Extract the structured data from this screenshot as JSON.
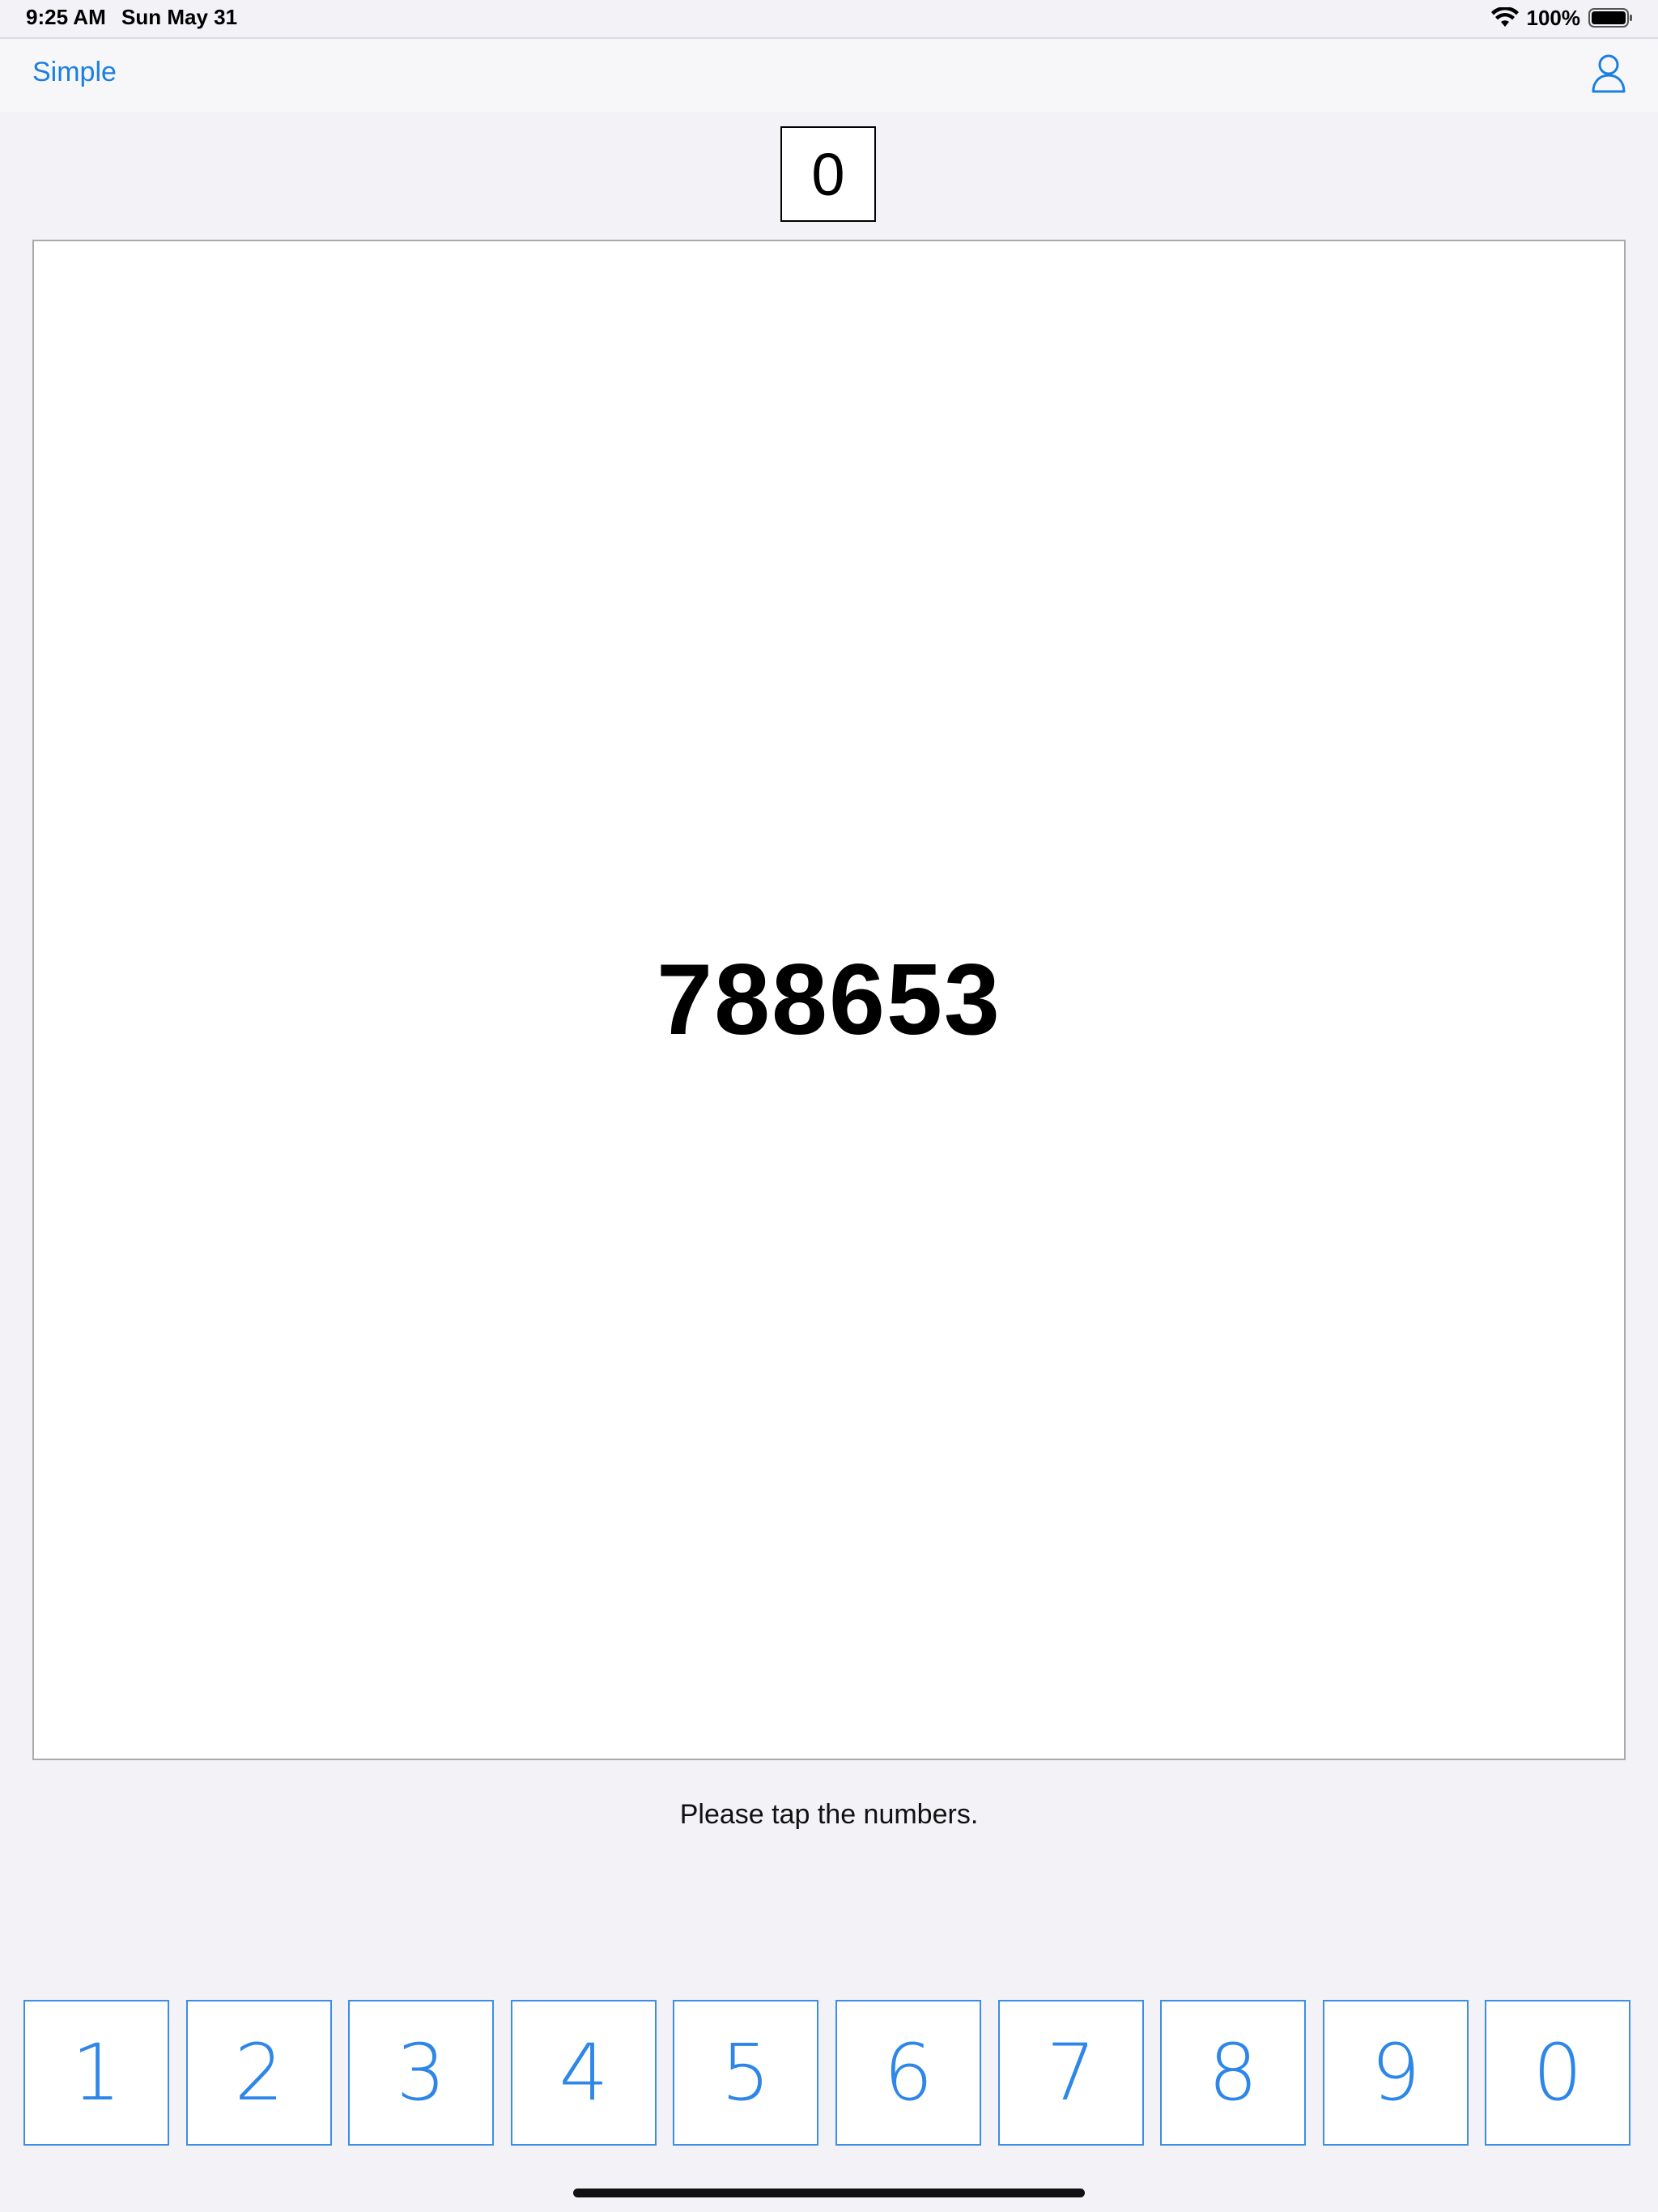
{
  "status_bar": {
    "time": "9:25 AM",
    "date": "Sun May 31",
    "battery": "100%",
    "icons": [
      "wifi-icon",
      "battery-icon"
    ]
  },
  "nav": {
    "back_label": "Simple",
    "user_icon": "person-icon"
  },
  "score": {
    "value": "0"
  },
  "display": {
    "number": "788653"
  },
  "instruction": "Please tap the numbers.",
  "keypad": {
    "keys": [
      "1",
      "2",
      "3",
      "4",
      "5",
      "6",
      "7",
      "8",
      "9",
      "0"
    ]
  },
  "colors": {
    "accent": "#2d86e8",
    "background": "#f2f2f7"
  }
}
